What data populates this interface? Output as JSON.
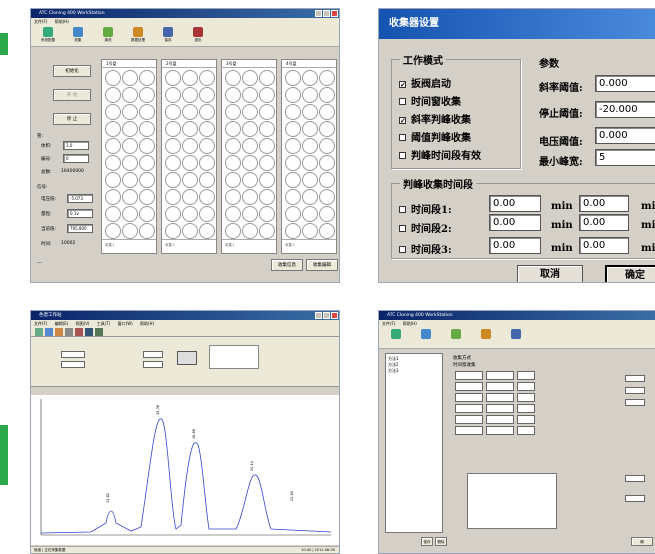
{
  "pane1": {
    "title": "ATC Cloning 400 WorkStation",
    "menu": [
      "文件(F)",
      "帮助(H)"
    ],
    "tools": [
      {
        "label": "系统配置",
        "color": "#3a7"
      },
      {
        "label": "收集",
        "color": "#48c"
      },
      {
        "label": "清洗",
        "color": "#6a4"
      },
      {
        "label": "数据处理",
        "color": "#c82"
      },
      {
        "label": "保存",
        "color": "#46a"
      },
      {
        "label": "退出",
        "color": "#a33"
      }
    ],
    "btn_init": "初始化",
    "btn_start": "开 始",
    "btn_stop": "停 止",
    "sec_tube": "管:",
    "vol_label": "体积:",
    "vol_value": "1.0",
    "no_label": "编号:",
    "no_value": "0",
    "total_label": "总数:",
    "total_value": "16400000",
    "sec_signal": "信号:",
    "v1_label": "电压值:",
    "v1_value": "-5.073",
    "range_label": "量程:",
    "range_value": "0.1v",
    "d_label": "当前值:",
    "d_value": "795.800",
    "t_label": "时间:",
    "t_value": "10002",
    "status": "---",
    "racks": [
      "1号盘",
      "2号盘",
      "3号盘",
      "4号盘"
    ],
    "rack_foot": "收集1",
    "btn_save": "收集信息",
    "btn_edit": "收集编辑"
  },
  "dialog": {
    "title": "收集器设置",
    "mode_title": "工作模式",
    "modes": [
      {
        "label": "扳阀启动",
        "checked": true
      },
      {
        "label": "时间窗收集",
        "checked": false
      },
      {
        "label": "斜率判峰收集",
        "checked": true
      },
      {
        "label": "阈值判峰收集",
        "checked": false
      },
      {
        "label": "判峰时间段有效",
        "checked": false
      }
    ],
    "param_title": "参数",
    "slope_label": "斜率阈值:",
    "slope_value": "0.000",
    "stop_label": "停止阈值:",
    "stop_value": "-20.000",
    "volt_label": "电压阈值:",
    "volt_value": "0.000",
    "minpeak_label": "最小峰宽:",
    "minpeak_value": "5",
    "period_title": "判峰收集时间段",
    "periods": [
      {
        "label": "时间段1:",
        "start": "0.00",
        "end": "0.00"
      },
      {
        "label": "时间段2:",
        "start": "0.00",
        "end": "0.00"
      },
      {
        "label": "时间段3:",
        "start": "0.00",
        "end": "0.00"
      }
    ],
    "unit": "min",
    "unit2": "mi",
    "cancel": "取消",
    "ok": "确定"
  },
  "pane3": {
    "title": "色谱工作站",
    "menu": [
      "文件(F)",
      "编辑(E)",
      "视图(V)",
      "工具(T)",
      "窗口(W)",
      "帮助(H)"
    ],
    "sb": "就绪 | 正在采集数据",
    "sb2": "10:40 | 2011-08-05",
    "peaks": [
      "11.82",
      "15.38",
      "16.89",
      "20.14",
      "22.60"
    ]
  },
  "pane4": {
    "title": "ATC Cloning 400 WorkStation",
    "menu": [
      "文件(F)",
      "帮助(H)"
    ],
    "list": [
      "方法1",
      "方法2",
      "方法3"
    ],
    "section": "收集方式",
    "collect_label": "时间窗收集",
    "btn_save": "保存",
    "btn_del": "删除",
    "btn_ok": "确"
  },
  "colors": {
    "green": "#2aa84a",
    "chart_line": "#3344cc"
  }
}
